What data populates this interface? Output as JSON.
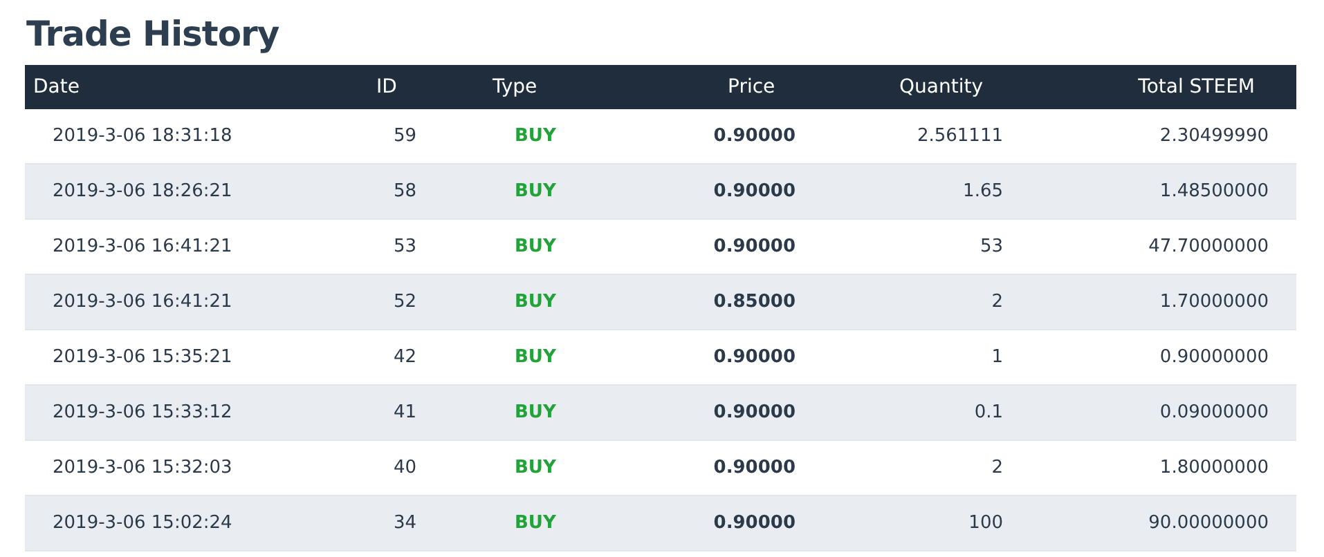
{
  "title": "Trade History",
  "table": {
    "columns": [
      "Date",
      "ID",
      "Type",
      "Price",
      "Quantity",
      "Total STEEM"
    ],
    "rows": [
      {
        "date": "2019-3-06 18:31:18",
        "id": "59",
        "type": "BUY",
        "price": "0.90000",
        "quantity": "2.561111",
        "total": "2.30499990"
      },
      {
        "date": "2019-3-06 18:26:21",
        "id": "58",
        "type": "BUY",
        "price": "0.90000",
        "quantity": "1.65",
        "total": "1.48500000"
      },
      {
        "date": "2019-3-06 16:41:21",
        "id": "53",
        "type": "BUY",
        "price": "0.90000",
        "quantity": "53",
        "total": "47.70000000"
      },
      {
        "date": "2019-3-06 16:41:21",
        "id": "52",
        "type": "BUY",
        "price": "0.85000",
        "quantity": "2",
        "total": "1.70000000"
      },
      {
        "date": "2019-3-06 15:35:21",
        "id": "42",
        "type": "BUY",
        "price": "0.90000",
        "quantity": "1",
        "total": "0.90000000"
      },
      {
        "date": "2019-3-06 15:33:12",
        "id": "41",
        "type": "BUY",
        "price": "0.90000",
        "quantity": "0.1",
        "total": "0.09000000"
      },
      {
        "date": "2019-3-06 15:32:03",
        "id": "40",
        "type": "BUY",
        "price": "0.90000",
        "quantity": "2",
        "total": "1.80000000"
      },
      {
        "date": "2019-3-06 15:02:24",
        "id": "34",
        "type": "BUY",
        "price": "0.90000",
        "quantity": "100",
        "total": "90.00000000"
      }
    ]
  }
}
